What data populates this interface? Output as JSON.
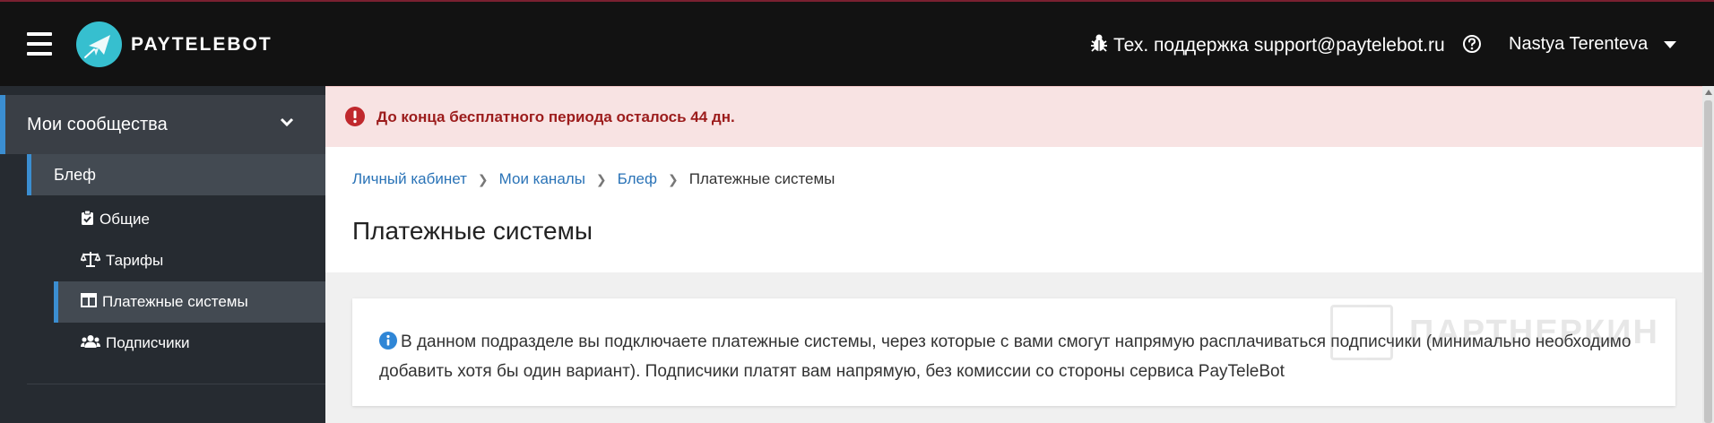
{
  "topbar": {
    "brand": "PAYTELEBOT",
    "support_label": "Тех. поддержка",
    "support_email": "support@paytelebot.ru",
    "user_name": "Nastya Terenteva"
  },
  "sidebar": {
    "section_label": "Мои сообщества",
    "channel_label": "Блеф",
    "items": [
      {
        "label": "Общие",
        "icon": "clipboard-check-icon"
      },
      {
        "label": "Тарифы",
        "icon": "balance-scale-icon"
      },
      {
        "label": "Платежные системы",
        "icon": "table-icon",
        "active": true
      },
      {
        "label": "Подписчики",
        "icon": "users-icon"
      }
    ]
  },
  "alert": {
    "text": "До конца бесплатного периода осталось 44 дн."
  },
  "breadcrumb": {
    "items": [
      "Личный кабинет",
      "Мои каналы",
      "Блеф"
    ],
    "current": "Платежные системы"
  },
  "page": {
    "title": "Платежные системы"
  },
  "info": {
    "text": "В данном подразделе вы подключаете платежные системы, через которые с вами смогут напрямую расплачиваться подписчики (минимально необходимо добавить хотя бы один вариант). Подписчики платят вам напрямую, без комиссии со стороны сервиса PayTeleBot"
  },
  "watermark": {
    "text": "ПАРТНЕРКИН"
  },
  "colors": {
    "topbar": "#121212",
    "sidebar": "#262b31",
    "accent": "#3b8ed1",
    "alert_bg": "#f8e3e3",
    "alert_text": "#9c1c1c",
    "link": "#2a73b7",
    "logo": "#36bfcf"
  }
}
